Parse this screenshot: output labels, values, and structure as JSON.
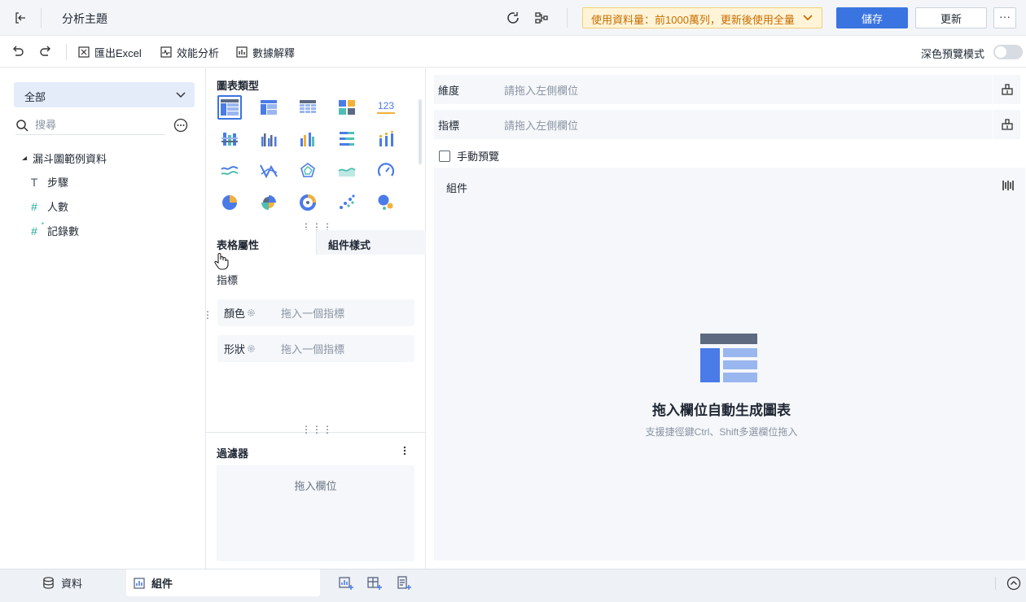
{
  "header": {
    "title": "分析主題",
    "usage_notice": "使用資料量：前1000萬列，更新後使用全量",
    "save_label": "儲存",
    "update_label": "更新",
    "more_label": "···"
  },
  "toolbar": {
    "export_label": "匯出Excel",
    "perf_label": "效能分析",
    "explain_label": "數據解釋",
    "dark_mode_label": "深色預覽模式",
    "dark_mode_on": false
  },
  "left": {
    "datasource": "全部",
    "search_placeholder": "搜尋",
    "table_name": "漏斗圖範例資料",
    "fields": [
      {
        "type_glyph": "T",
        "name": "步驟",
        "color": "#4a5566"
      },
      {
        "type_glyph": "#",
        "name": "人數",
        "color": "#1ea79a"
      },
      {
        "type_glyph": "#",
        "name": "記錄數",
        "color": "#1ea79a"
      }
    ]
  },
  "middle": {
    "chart_type_title": "圖表類型",
    "tab_table": "表格屬性",
    "tab_style": "組件樣式",
    "metrics_title": "指標",
    "color_label": "顏色",
    "color_placeholder": "拖入一個指標",
    "shape_label": "形狀",
    "shape_placeholder": "拖入一個指標",
    "filter_title": "過濾器",
    "filter_placeholder": "拖入欄位",
    "kpi_text": "123"
  },
  "right": {
    "dimension_label": "維度",
    "dimension_placeholder": "請拖入左側欄位",
    "metric_label": "指標",
    "metric_placeholder": "請拖入左側欄位",
    "manual_preview_label": "手動預覽",
    "canvas_title": "組件",
    "empty_title": "拖入欄位自動生成圖表",
    "empty_subtitle": "支援捷徑鍵Ctrl、Shift多選欄位拖入"
  },
  "bottom": {
    "data_tab": "資料",
    "component_tab": "組件"
  },
  "colors": {
    "primary": "#3a74e0",
    "warning_bg": "#fff4d8",
    "warning_text": "#c76d00",
    "field_number": "#1ea79a"
  }
}
